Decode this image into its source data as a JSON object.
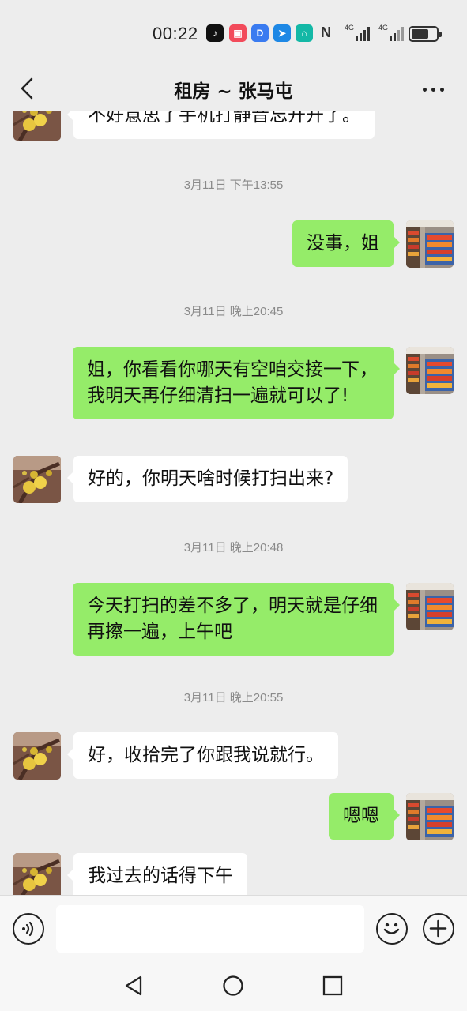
{
  "status_bar": {
    "time": "00:22",
    "network_label": "4G",
    "apps": [
      {
        "name": "tiktok-icon",
        "glyph": "♪",
        "color": "#111111"
      },
      {
        "name": "red-app-icon",
        "glyph": "▣",
        "color": "#f24b5b"
      },
      {
        "name": "blue-d-app-icon",
        "glyph": "D",
        "color": "#3a7bf0"
      },
      {
        "name": "blue-arrow-app-icon",
        "glyph": "➤",
        "color": "#1e88e5"
      },
      {
        "name": "home-app-icon",
        "glyph": "⌂",
        "color": "#14b8a6"
      }
    ],
    "nfc_label": "N",
    "battery_level": 0.62
  },
  "header": {
    "title": "租房 ~ 张马屯"
  },
  "messages": {
    "m0": "不好意思了手机打静音忘开开了。",
    "t1": "3月11日 下午13:55",
    "m1": "没事，姐",
    "t2": "3月11日 晚上20:45",
    "m2": "姐，你看看你哪天有空咱交接一下，我明天再仔细清扫一遍就可以了!",
    "m3": "好的，你明天啥时候打扫出来?",
    "t3": "3月11日 晚上20:48",
    "m4": "今天打扫的差不多了，明天就是仔细再擦一遍，上午吧",
    "t4": "3月11日 晚上20:55",
    "m5": "好，收拾完了你跟我说就行。",
    "m6": "嗯嗯",
    "m7": "我过去的话得下午"
  },
  "input": {
    "placeholder": ""
  },
  "colors": {
    "outgoing_bubble": "#95ec69",
    "incoming_bubble": "#ffffff",
    "background": "#ededed"
  }
}
